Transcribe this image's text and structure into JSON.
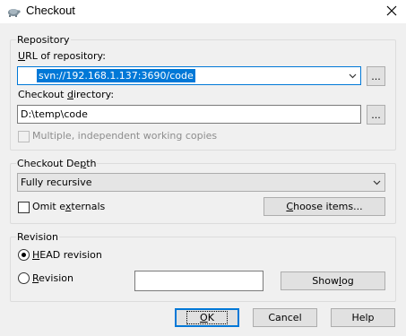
{
  "window": {
    "title": "Checkout",
    "icon": "tortoise-svn-icon"
  },
  "repository": {
    "group_label": "Repository",
    "url_label_prefix": "U",
    "url_label_rest": "RL of repository:",
    "url_value": "svn://192.168.1.137:3690/code",
    "browse_label": "...",
    "dir_label_prefix": "Checkout ",
    "dir_label_u": "d",
    "dir_label_rest": "irectory:",
    "dir_value": "D:\\temp\\code",
    "dir_browse_label": "...",
    "multiple_label": "Multiple, independent working copies"
  },
  "depth": {
    "group_label_prefix": "Checkout De",
    "group_label_u": "p",
    "group_label_rest": "th",
    "selected": "Fully recursive",
    "omit_prefix": "Omit e",
    "omit_u": "x",
    "omit_rest": "ternals",
    "choose_u": "C",
    "choose_rest": "hoose items..."
  },
  "revision": {
    "group_label": "Revision",
    "head_u": "H",
    "head_rest": "EAD revision",
    "rev_u": "R",
    "rev_rest": "evision",
    "rev_value": "",
    "show_log_prefix": "Show ",
    "show_log_u": "l",
    "show_log_rest": "og"
  },
  "buttons": {
    "ok_u": "O",
    "ok_rest": "K",
    "cancel": "Cancel",
    "help": "Help"
  }
}
